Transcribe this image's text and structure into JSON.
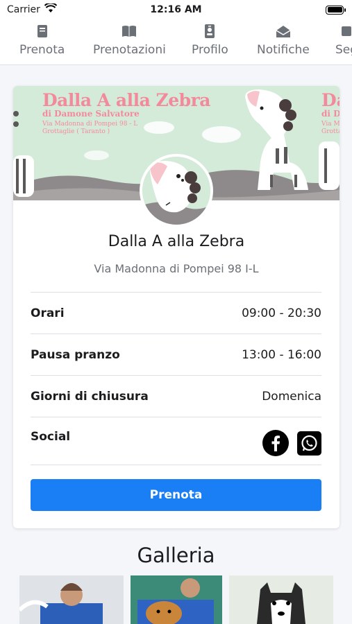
{
  "status_bar": {
    "carrier": "Carrier",
    "time": "12:16 AM"
  },
  "tabs": [
    {
      "label": "Prenota",
      "icon": "book-closed-icon"
    },
    {
      "label": "Prenotazioni",
      "icon": "book-open-icon"
    },
    {
      "label": "Profilo",
      "icon": "id-badge-icon"
    },
    {
      "label": "Notifiche",
      "icon": "envelope-open-icon"
    },
    {
      "label": "Seg",
      "icon": "more-icon"
    }
  ],
  "banner": {
    "title": "Dalla A alla Zebra",
    "subtitle": "di Damone Salvatore",
    "address_line1": "Via Madonna di Pompei 98 - L",
    "address_line2": "Grottaglie ( Taranto )",
    "title_repeat": "Dal",
    "subtitle_repeat": "di Dam",
    "address_repeat_line1": "Via Mad",
    "address_repeat_line2": "Grottag"
  },
  "shop": {
    "name": "Dalla A alla Zebra",
    "address": "Via Madonna di Pompei 98 I-L"
  },
  "info": [
    {
      "label": "Orari",
      "value": "09:00 - 20:30"
    },
    {
      "label": "Pausa pranzo",
      "value": "13:00 - 16:00"
    },
    {
      "label": "Giorni di chiusura",
      "value": "Domenica"
    },
    {
      "label": "Social",
      "value": ""
    }
  ],
  "social": [
    "facebook-icon",
    "whatsapp-icon"
  ],
  "book_button_label": "Prenota",
  "gallery": {
    "title": "Galleria"
  },
  "colors": {
    "accent": "#1a7ef5",
    "banner_bg": "#d5ebd9",
    "banner_text": "#f28a9c",
    "tab_text": "#6b6f76"
  }
}
